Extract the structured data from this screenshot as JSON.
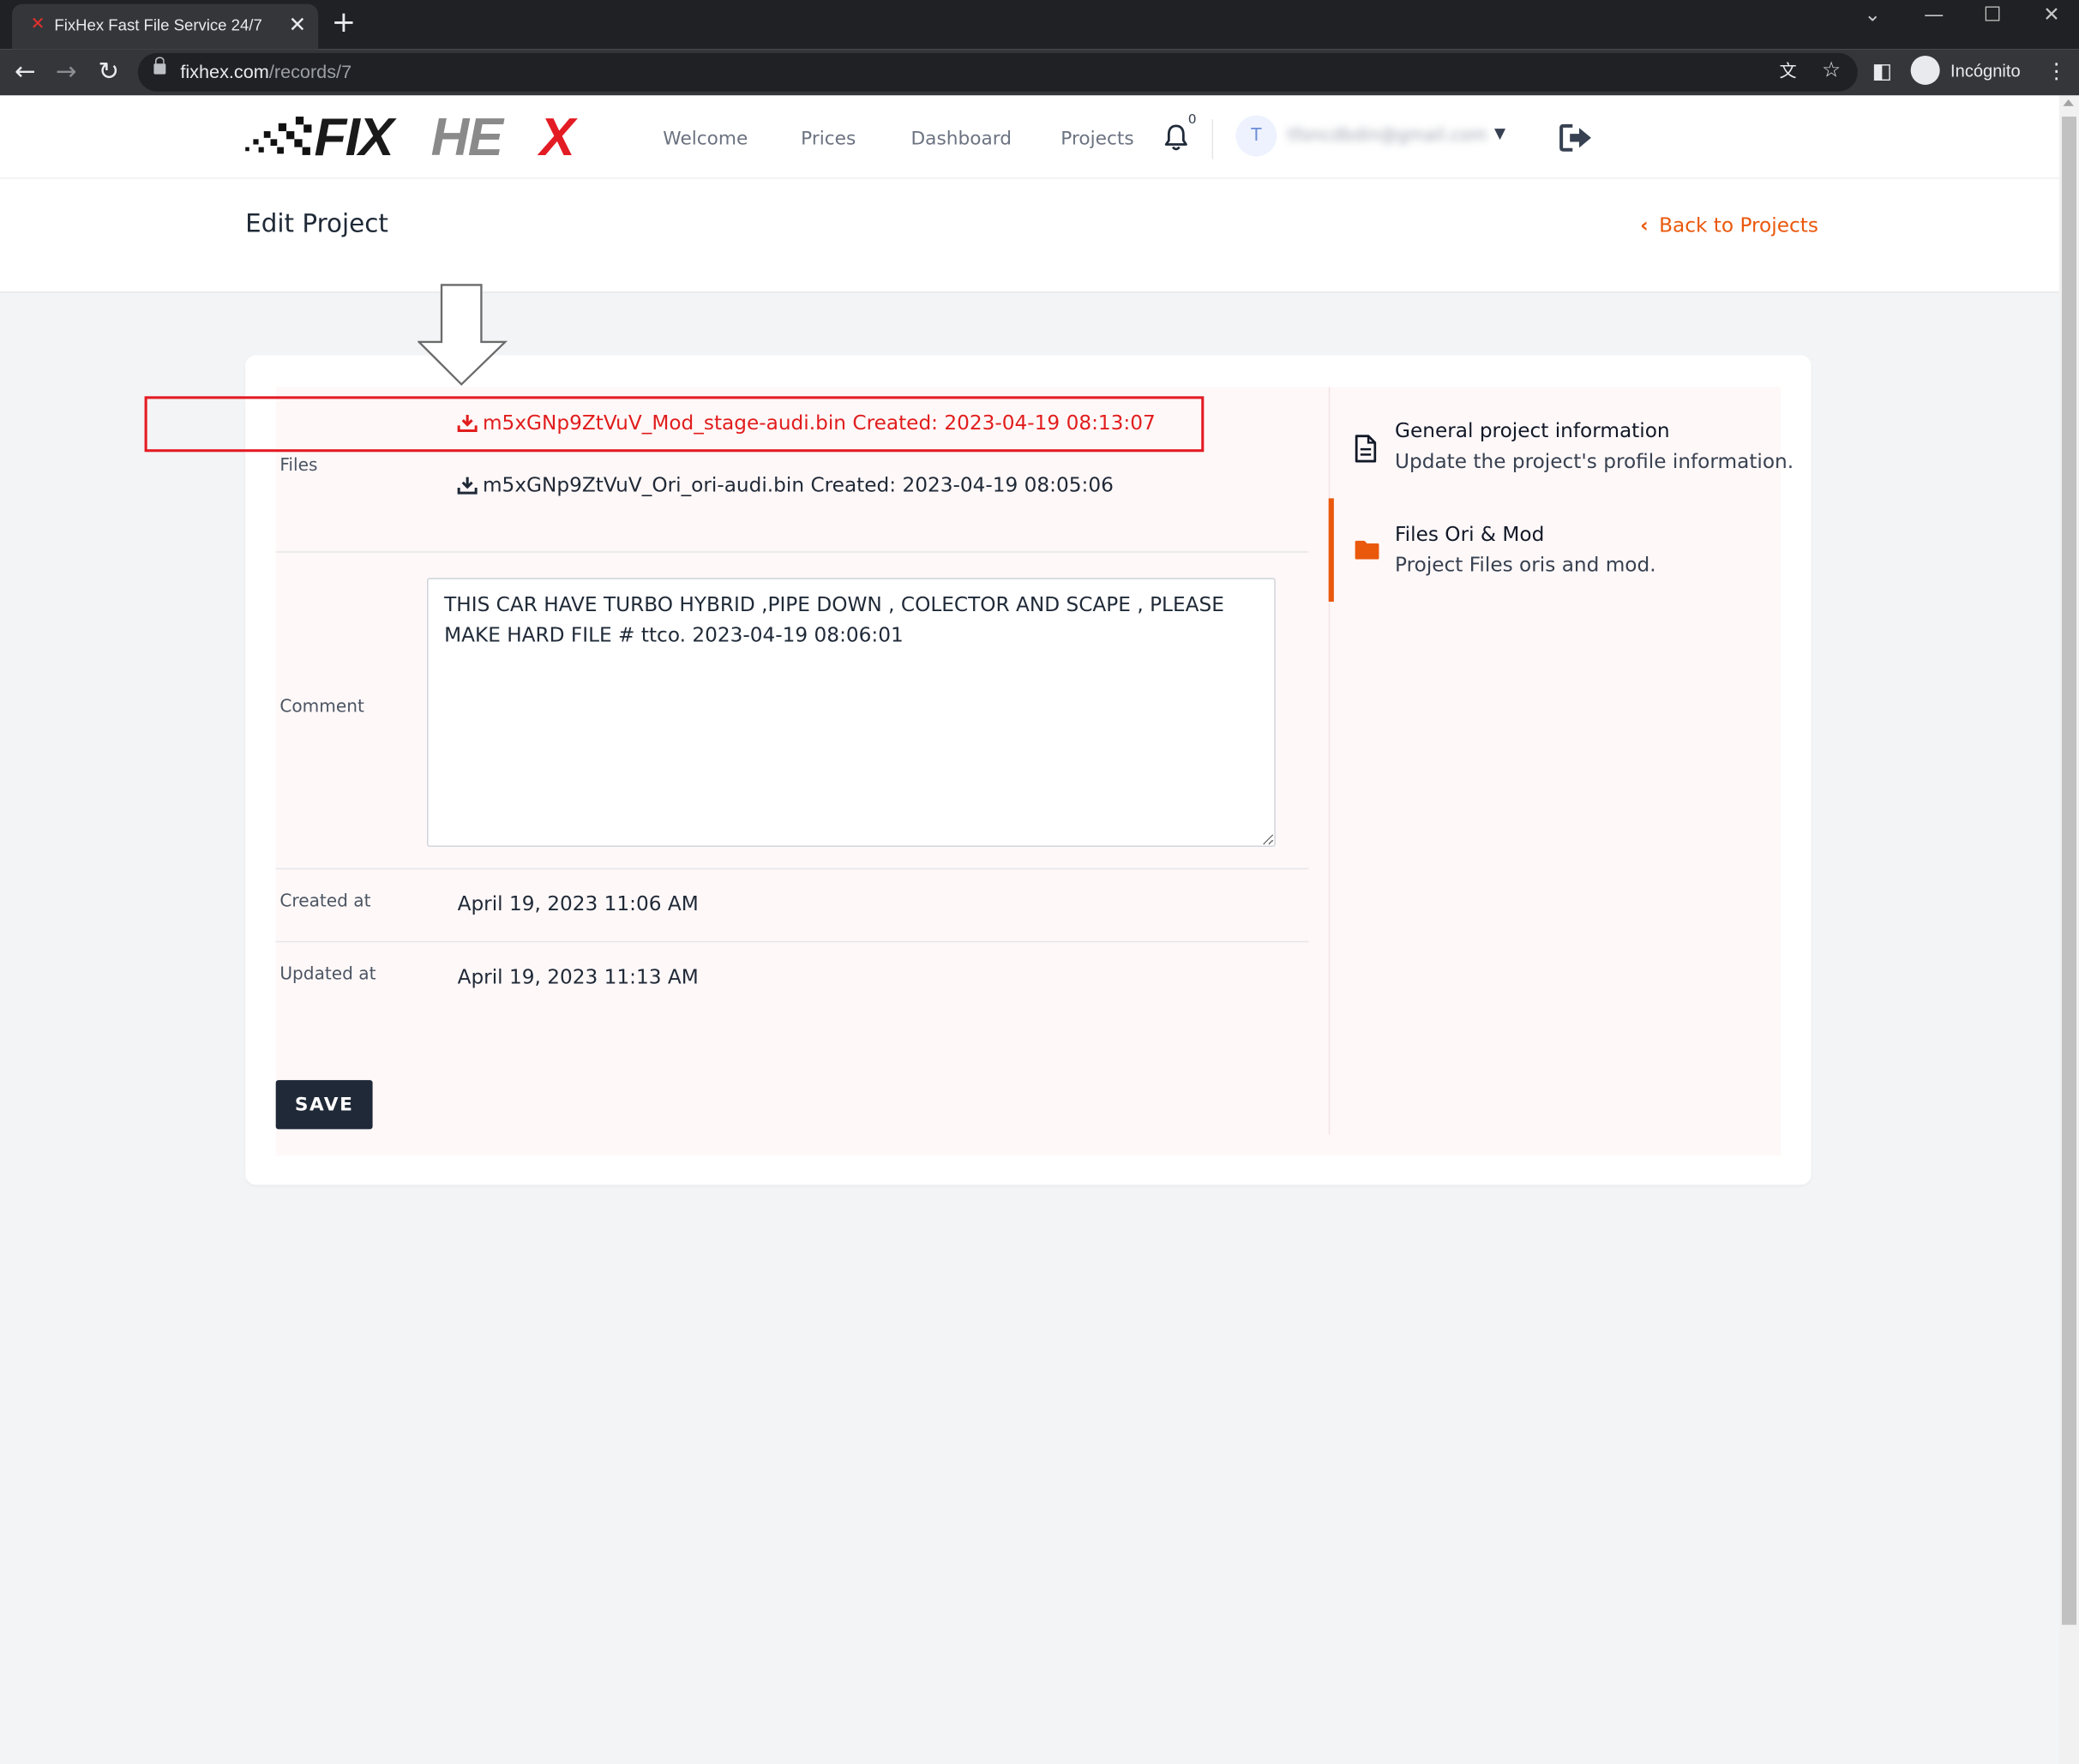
{
  "browser": {
    "tab_title": "FixHex Fast File Service 24/7",
    "tab_favicon": "✕",
    "url_host": "fixhex.com",
    "url_path": "/records/7",
    "incognito_label": "Incógnito"
  },
  "nav": {
    "logo_text": "FIXHEX",
    "links": [
      "Welcome",
      "Prices",
      "Dashboard",
      "Projects"
    ],
    "notification_count": "0",
    "user_initial": "T",
    "user_email": "tfoncdbdin@gmail.com"
  },
  "page": {
    "title": "Edit Project",
    "back_link": "Back to Projects"
  },
  "form": {
    "files_label": "Files",
    "files": [
      {
        "name": "m5xGNp9ZtVuV_Mod_stage-audi.bin",
        "created": "Created: 2023-04-19 08:13:07"
      },
      {
        "name": "m5xGNp9ZtVuV_Ori_ori-audi.bin",
        "created": "Created: 2023-04-19 08:05:06"
      }
    ],
    "comment_label": "Comment",
    "comment_value": "THIS CAR HAVE TURBO HYBRID ,PIPE DOWN , COLECTOR AND SCAPE , PLEASE MAKE HARD FILE # ttco. 2023-04-19 08:06:01",
    "created_label": "Created at",
    "created_value": "April 19, 2023 11:06 AM",
    "updated_label": "Updated at",
    "updated_value": "April 19, 2023 11:13 AM",
    "save_label": "SAVE"
  },
  "sidebar": {
    "items": [
      {
        "title": "General project information",
        "desc": "Update the project's profile information.",
        "icon": "document-icon"
      },
      {
        "title": "Files Ori & Mod",
        "desc": "Project Files oris and mod.",
        "icon": "folder-icon"
      }
    ]
  },
  "colors": {
    "accent": "#ea580c",
    "highlight_red": "#e31b23",
    "button_dark": "#1f2937"
  }
}
